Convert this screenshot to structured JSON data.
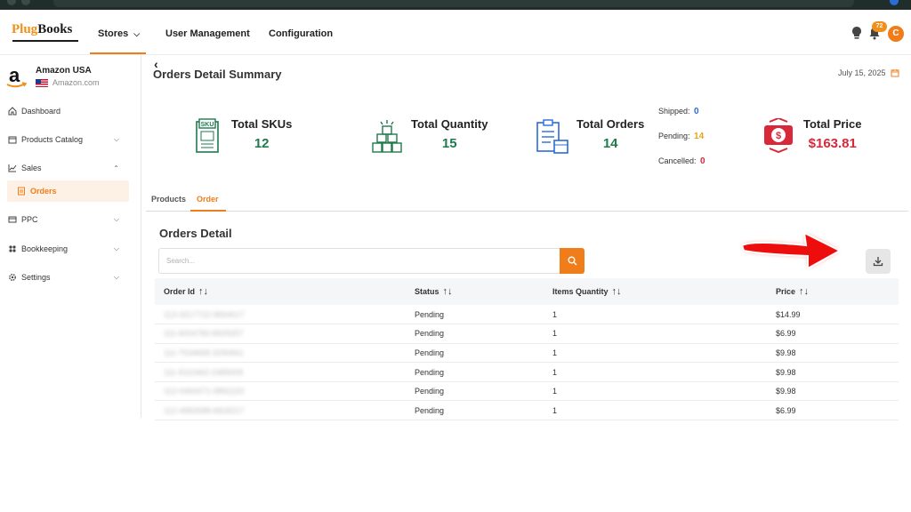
{
  "brand": {
    "logo_part1": "Plug",
    "logo_part2": "Books"
  },
  "nav": {
    "stores": "Stores",
    "user_management": "User Management",
    "configuration": "Configuration"
  },
  "header_right": {
    "notification_count": "72",
    "avatar_initial": "C"
  },
  "store": {
    "name": "Amazon USA",
    "domain": "Amazon.com"
  },
  "sidebar": {
    "items": [
      {
        "label": "Dashboard",
        "icon": "home-icon"
      },
      {
        "label": "Products Catalog",
        "icon": "box-icon"
      },
      {
        "label": "Sales",
        "icon": "chart-icon"
      },
      {
        "label": "Orders",
        "icon": "orders-icon"
      },
      {
        "label": "PPC",
        "icon": "card-icon"
      },
      {
        "label": "Bookkeeping",
        "icon": "ledger-icon"
      },
      {
        "label": "Settings",
        "icon": "gear-icon"
      }
    ]
  },
  "page": {
    "title": "Orders Detail Summary",
    "date": "July 15, 2025"
  },
  "stats": {
    "skus": {
      "label": "Total SKUs",
      "value": "12",
      "icon_text": "SKU"
    },
    "quantity": {
      "label": "Total Quantity",
      "value": "15"
    },
    "orders": {
      "label": "Total Orders",
      "value": "14"
    },
    "price": {
      "label": "Total Price",
      "value": "$163.81"
    }
  },
  "order_status": {
    "shipped_label": "Shipped:",
    "shipped": "0",
    "pending_label": "Pending:",
    "pending": "14",
    "cancelled_label": "Cancelled:",
    "cancelled": "0"
  },
  "tabs": {
    "products": "Products",
    "order": "Order"
  },
  "orders_detail": {
    "title": "Orders Detail",
    "search_placeholder": "Search...",
    "columns": [
      "Order Id",
      "Status",
      "Items Quantity",
      "Price"
    ],
    "rows": [
      {
        "order_id": "113-3217722-9654617",
        "status": "Pending",
        "qty": "1",
        "price": "$14.99"
      },
      {
        "order_id": "111-6004783-8929257",
        "status": "Pending",
        "qty": "1",
        "price": "$6.99"
      },
      {
        "order_id": "111-7534658-3290661",
        "status": "Pending",
        "qty": "1",
        "price": "$9.98"
      },
      {
        "order_id": "111-9110462-2489009",
        "status": "Pending",
        "qty": "1",
        "price": "$9.98"
      },
      {
        "order_id": "112-0460471-0892220",
        "status": "Pending",
        "qty": "1",
        "price": "$9.98"
      },
      {
        "order_id": "112-4982688-6818217",
        "status": "Pending",
        "qty": "1",
        "price": "$6.99"
      }
    ]
  },
  "colors": {
    "accent": "#f07c1a",
    "value_green": "#1f7a4d",
    "price_red": "#d8283a",
    "shipped_blue": "#2b6cd8",
    "pending_orange": "#e8a317"
  }
}
